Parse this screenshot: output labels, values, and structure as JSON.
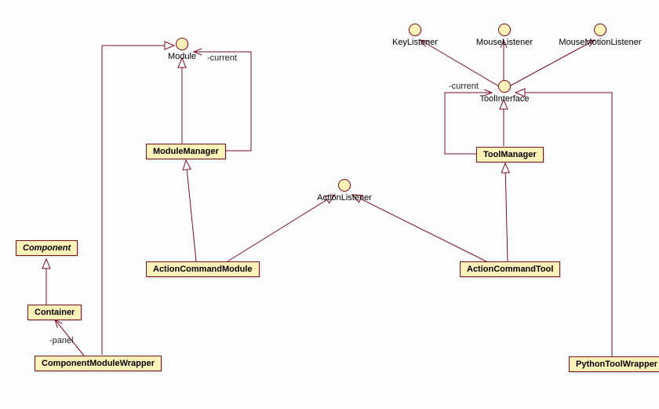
{
  "interfaces": {
    "module": "Module",
    "actionListener": "ActionListener",
    "toolInterface": "ToolInterface",
    "keyListener": "KeyListener",
    "mouseListener": "MouseListener",
    "mouseMotionListener": "MouseMotionListener"
  },
  "classes": {
    "component": "Component",
    "container": "Container",
    "componentModuleWrapper": "ComponentModuleWrapper",
    "moduleManager": "ModuleManager",
    "actionCommandModule": "ActionCommandModule",
    "toolManager": "ToolManager",
    "actionCommandTool": "ActionCommandTool",
    "pythonToolWrapper": "PythonToolWrapper"
  },
  "edgeLabels": {
    "moduleCurrent": "-current",
    "toolCurrent": "-current",
    "panel": "-panel"
  }
}
